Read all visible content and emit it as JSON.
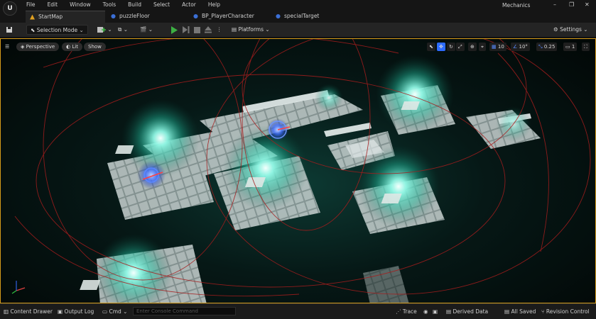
{
  "menu": {
    "items": [
      "File",
      "Edit",
      "Window",
      "Tools",
      "Build",
      "Select",
      "Actor",
      "Help"
    ],
    "project_name": "Mechanics",
    "logo_text": "U"
  },
  "tabs": [
    {
      "label": "StartMap",
      "active": true,
      "icon": "level-icon"
    },
    {
      "label": "puzzleFloor",
      "active": false,
      "icon": "blueprint-icon"
    },
    {
      "label": "BP_PlayerCharacter",
      "active": false,
      "icon": "blueprint-icon"
    },
    {
      "label": "specialTarget",
      "active": false,
      "icon": "blueprint-icon"
    }
  ],
  "toolbar": {
    "selection_mode": "Selection Mode",
    "platforms": "Platforms",
    "settings": "Settings"
  },
  "viewport": {
    "perspective": "Perspective",
    "lit": "Lit",
    "show": "Show",
    "grid_snap": "10",
    "rotation_snap": "10°",
    "scale_snap": "0.25",
    "camera_speed": "1"
  },
  "statusbar": {
    "content_drawer": "Content Drawer",
    "output_log": "Output Log",
    "cmd": "Cmd",
    "console_placeholder": "Enter Console Command",
    "trace": "Trace",
    "derived_data": "Derived Data",
    "all_saved": "All Saved",
    "revision_control": "Revision Control"
  },
  "colors": {
    "accent_border": "#d59b1a",
    "play_green": "#3cb043",
    "light_teal": "#4ef0d0",
    "selected_blue": "#2d6cff"
  }
}
